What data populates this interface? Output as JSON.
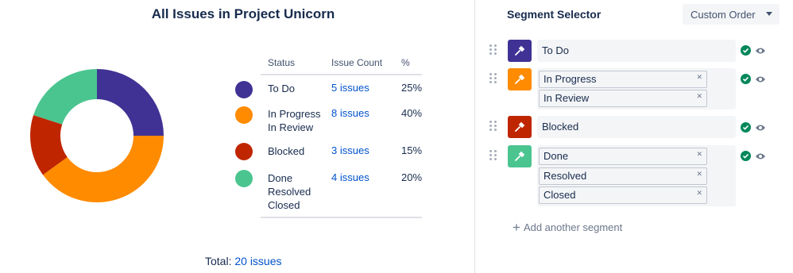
{
  "chart": {
    "title": "All Issues in Project Unicorn",
    "total_label": "Total:",
    "total_link": "20 issues"
  },
  "chart_data": {
    "type": "pie",
    "title": "All Issues in Project Unicorn",
    "categories": [
      "To Do",
      "In Progress / In Review",
      "Blocked",
      "Done / Resolved / Closed"
    ],
    "values": [
      5,
      8,
      3,
      4
    ],
    "percent": [
      25,
      40,
      15,
      20
    ],
    "colors": [
      "#403294",
      "#ff8b00",
      "#bf2600",
      "#4bc590"
    ]
  },
  "legend": {
    "headers": {
      "status": "Status",
      "count": "Issue Count",
      "pct": "%"
    },
    "rows": [
      {
        "status": [
          "To Do"
        ],
        "count": "5 issues",
        "pct": "25%",
        "color": "#403294"
      },
      {
        "status": [
          "In Progress",
          "In Review"
        ],
        "count": "8 issues",
        "pct": "40%",
        "color": "#ff8b00"
      },
      {
        "status": [
          "Blocked"
        ],
        "count": "3 issues",
        "pct": "15%",
        "color": "#bf2600"
      },
      {
        "status": [
          "Done",
          "Resolved",
          "Closed"
        ],
        "count": "4 issues",
        "pct": "20%",
        "color": "#4bc590"
      }
    ]
  },
  "selector": {
    "title": "Segment Selector",
    "order_label": "Custom Order",
    "add_label": "Add another segment",
    "segments": [
      {
        "color": "#403294",
        "single": "To Do",
        "chips": []
      },
      {
        "color": "#ff8b00",
        "single": null,
        "chips": [
          "In Progress",
          "In Review"
        ]
      },
      {
        "color": "#bf2600",
        "single": "Blocked",
        "chips": []
      },
      {
        "color": "#4bc590",
        "single": null,
        "chips": [
          "Done",
          "Resolved",
          "Closed"
        ]
      }
    ]
  }
}
